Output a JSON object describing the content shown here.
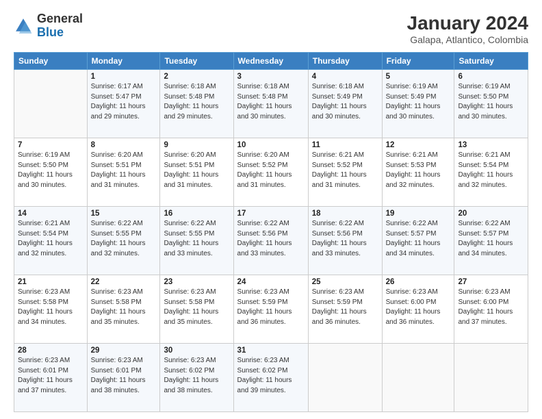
{
  "header": {
    "logo": {
      "general": "General",
      "blue": "Blue"
    },
    "title": "January 2024",
    "location": "Galapa, Atlantico, Colombia"
  },
  "days_of_week": [
    "Sunday",
    "Monday",
    "Tuesday",
    "Wednesday",
    "Thursday",
    "Friday",
    "Saturday"
  ],
  "weeks": [
    [
      {
        "day": "",
        "sunrise": "",
        "sunset": "",
        "daylight": ""
      },
      {
        "day": "1",
        "sunrise": "6:17 AM",
        "sunset": "5:47 PM",
        "daylight": "11 hours and 29 minutes."
      },
      {
        "day": "2",
        "sunrise": "6:18 AM",
        "sunset": "5:48 PM",
        "daylight": "11 hours and 29 minutes."
      },
      {
        "day": "3",
        "sunrise": "6:18 AM",
        "sunset": "5:48 PM",
        "daylight": "11 hours and 30 minutes."
      },
      {
        "day": "4",
        "sunrise": "6:18 AM",
        "sunset": "5:49 PM",
        "daylight": "11 hours and 30 minutes."
      },
      {
        "day": "5",
        "sunrise": "6:19 AM",
        "sunset": "5:49 PM",
        "daylight": "11 hours and 30 minutes."
      },
      {
        "day": "6",
        "sunrise": "6:19 AM",
        "sunset": "5:50 PM",
        "daylight": "11 hours and 30 minutes."
      }
    ],
    [
      {
        "day": "7",
        "sunrise": "6:19 AM",
        "sunset": "5:50 PM",
        "daylight": "11 hours and 30 minutes."
      },
      {
        "day": "8",
        "sunrise": "6:20 AM",
        "sunset": "5:51 PM",
        "daylight": "11 hours and 31 minutes."
      },
      {
        "day": "9",
        "sunrise": "6:20 AM",
        "sunset": "5:51 PM",
        "daylight": "11 hours and 31 minutes."
      },
      {
        "day": "10",
        "sunrise": "6:20 AM",
        "sunset": "5:52 PM",
        "daylight": "11 hours and 31 minutes."
      },
      {
        "day": "11",
        "sunrise": "6:21 AM",
        "sunset": "5:52 PM",
        "daylight": "11 hours and 31 minutes."
      },
      {
        "day": "12",
        "sunrise": "6:21 AM",
        "sunset": "5:53 PM",
        "daylight": "11 hours and 32 minutes."
      },
      {
        "day": "13",
        "sunrise": "6:21 AM",
        "sunset": "5:54 PM",
        "daylight": "11 hours and 32 minutes."
      }
    ],
    [
      {
        "day": "14",
        "sunrise": "6:21 AM",
        "sunset": "5:54 PM",
        "daylight": "11 hours and 32 minutes."
      },
      {
        "day": "15",
        "sunrise": "6:22 AM",
        "sunset": "5:55 PM",
        "daylight": "11 hours and 32 minutes."
      },
      {
        "day": "16",
        "sunrise": "6:22 AM",
        "sunset": "5:55 PM",
        "daylight": "11 hours and 33 minutes."
      },
      {
        "day": "17",
        "sunrise": "6:22 AM",
        "sunset": "5:56 PM",
        "daylight": "11 hours and 33 minutes."
      },
      {
        "day": "18",
        "sunrise": "6:22 AM",
        "sunset": "5:56 PM",
        "daylight": "11 hours and 33 minutes."
      },
      {
        "day": "19",
        "sunrise": "6:22 AM",
        "sunset": "5:57 PM",
        "daylight": "11 hours and 34 minutes."
      },
      {
        "day": "20",
        "sunrise": "6:22 AM",
        "sunset": "5:57 PM",
        "daylight": "11 hours and 34 minutes."
      }
    ],
    [
      {
        "day": "21",
        "sunrise": "6:23 AM",
        "sunset": "5:58 PM",
        "daylight": "11 hours and 34 minutes."
      },
      {
        "day": "22",
        "sunrise": "6:23 AM",
        "sunset": "5:58 PM",
        "daylight": "11 hours and 35 minutes."
      },
      {
        "day": "23",
        "sunrise": "6:23 AM",
        "sunset": "5:58 PM",
        "daylight": "11 hours and 35 minutes."
      },
      {
        "day": "24",
        "sunrise": "6:23 AM",
        "sunset": "5:59 PM",
        "daylight": "11 hours and 36 minutes."
      },
      {
        "day": "25",
        "sunrise": "6:23 AM",
        "sunset": "5:59 PM",
        "daylight": "11 hours and 36 minutes."
      },
      {
        "day": "26",
        "sunrise": "6:23 AM",
        "sunset": "6:00 PM",
        "daylight": "11 hours and 36 minutes."
      },
      {
        "day": "27",
        "sunrise": "6:23 AM",
        "sunset": "6:00 PM",
        "daylight": "11 hours and 37 minutes."
      }
    ],
    [
      {
        "day": "28",
        "sunrise": "6:23 AM",
        "sunset": "6:01 PM",
        "daylight": "11 hours and 37 minutes."
      },
      {
        "day": "29",
        "sunrise": "6:23 AM",
        "sunset": "6:01 PM",
        "daylight": "11 hours and 38 minutes."
      },
      {
        "day": "30",
        "sunrise": "6:23 AM",
        "sunset": "6:02 PM",
        "daylight": "11 hours and 38 minutes."
      },
      {
        "day": "31",
        "sunrise": "6:23 AM",
        "sunset": "6:02 PM",
        "daylight": "11 hours and 39 minutes."
      },
      {
        "day": "",
        "sunrise": "",
        "sunset": "",
        "daylight": ""
      },
      {
        "day": "",
        "sunrise": "",
        "sunset": "",
        "daylight": ""
      },
      {
        "day": "",
        "sunrise": "",
        "sunset": "",
        "daylight": ""
      }
    ]
  ]
}
